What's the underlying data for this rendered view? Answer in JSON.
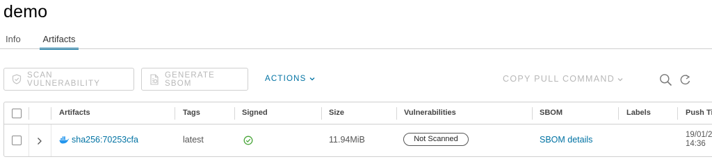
{
  "page": {
    "title": "demo"
  },
  "tabs": [
    {
      "label": "Info"
    },
    {
      "label": "Artifacts"
    }
  ],
  "toolbar": {
    "scan_label": "SCAN VULNERABILITY",
    "sbom_label": "GENERATE SBOM",
    "actions_label": "ACTIONS",
    "copy_pull_label": "COPY PULL COMMAND"
  },
  "table": {
    "columns": [
      "Artifacts",
      "Tags",
      "Signed",
      "Size",
      "Vulnerabilities",
      "SBOM",
      "Labels",
      "Push Time"
    ],
    "rows": [
      {
        "artifact": "sha256:70253cfa",
        "tag": "latest",
        "signed_icon": "check-circle-icon",
        "size": "11.94MiB",
        "vulnerabilities": "Not Scanned",
        "sbom": "SBOM details",
        "labels": "",
        "push_date": "19/01/2",
        "push_time": "14:36"
      }
    ]
  },
  "colors": {
    "link": "#0072a3",
    "success": "#2f8400",
    "disabled_text": "#b8b8b8"
  }
}
